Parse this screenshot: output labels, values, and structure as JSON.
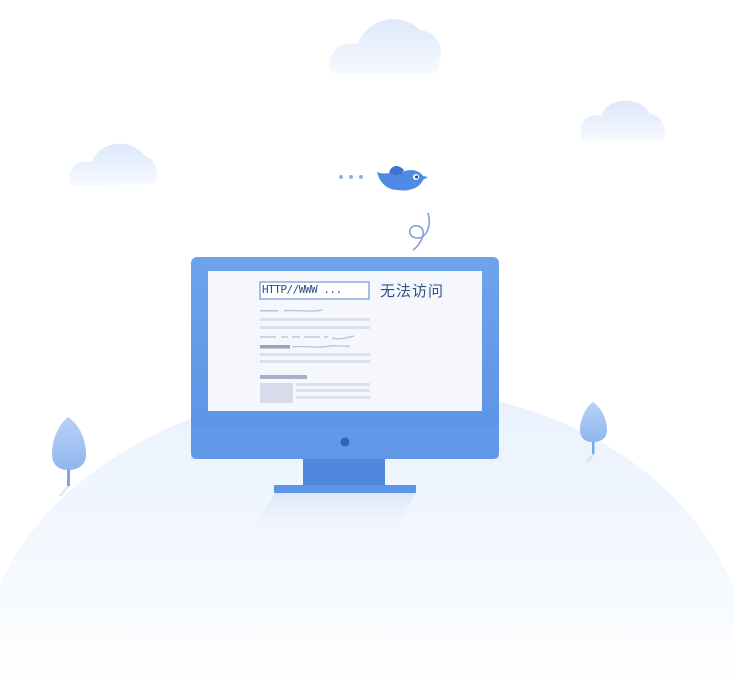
{
  "browser": {
    "url": "HTTP//WWW ...",
    "error_message": "无法访问"
  },
  "colors": {
    "monitor_blue": "#5b95e6",
    "screen_bg": "#f6f7fc",
    "cloud": "#e3ecfb",
    "hill": "#eef5fe",
    "bird": "#4f8ae4"
  },
  "icons": {
    "bird": "bird-icon",
    "monitor": "monitor-icon",
    "cloud": "cloud-icon",
    "tree": "tree-icon"
  }
}
